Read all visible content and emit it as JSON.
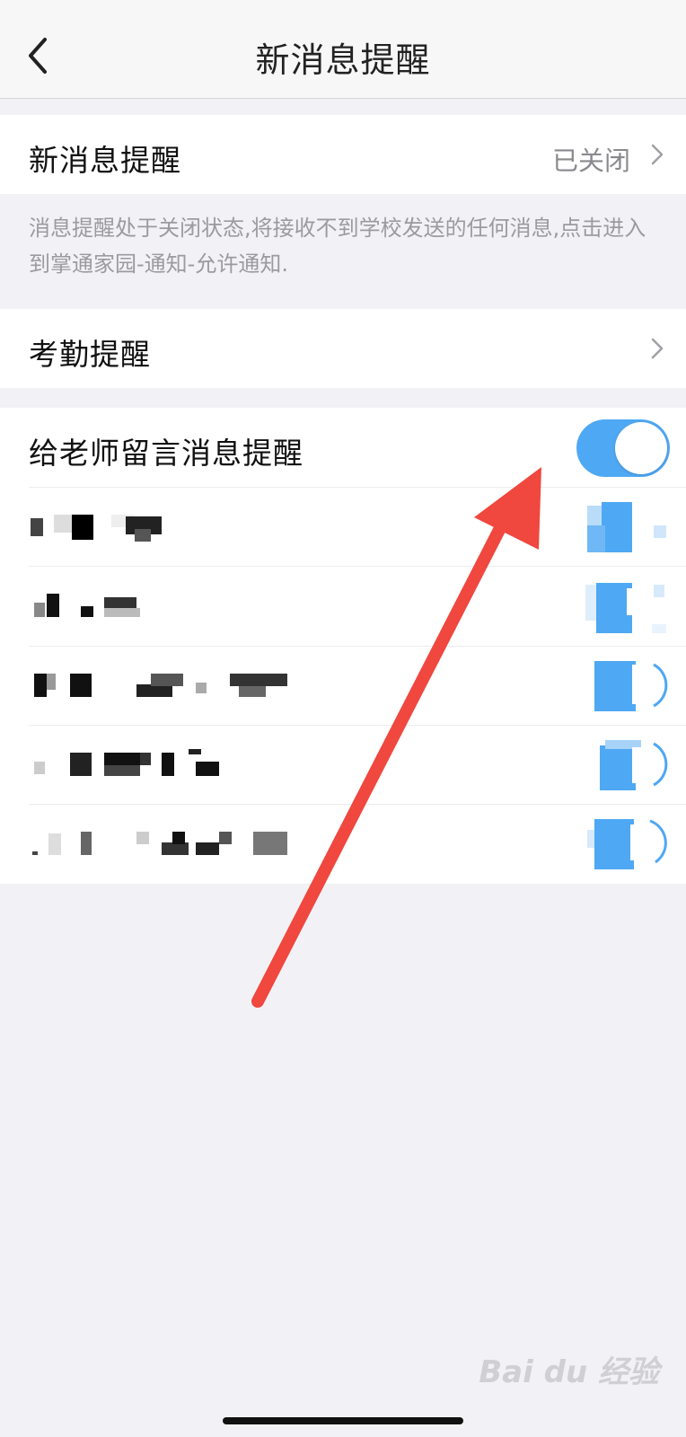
{
  "navbar": {
    "title": "新消息提醒"
  },
  "sections": {
    "new_message": {
      "label": "新消息提醒",
      "value": "已关闭"
    },
    "hint": "消息提醒处于关闭状态,将接收不到学校发送的任何消息,点击进入到掌通家园-通知-允许通知.",
    "attendance": {
      "label": "考勤提醒"
    },
    "teacher_message": {
      "label": "给老师留言消息提醒",
      "enabled": true
    }
  },
  "colors": {
    "accent": "#4fa8f3",
    "arrow": "#f0473e",
    "background": "#f2f2f6"
  },
  "icons": {
    "back": "chevron-left-icon",
    "disclosure": "chevron-right-icon"
  },
  "watermark": "Bai du 经验"
}
